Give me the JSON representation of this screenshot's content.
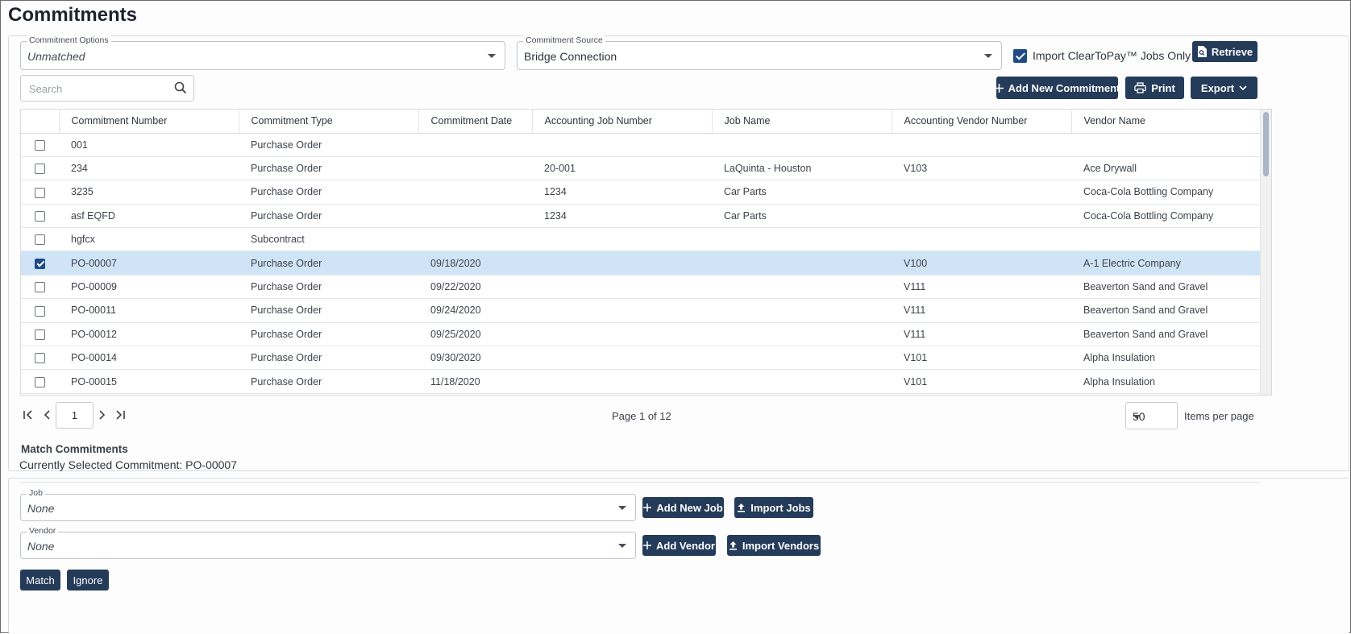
{
  "page": {
    "title": "Commitments"
  },
  "filters": {
    "options_label": "Commitment Options",
    "options_value": "Unmatched",
    "source_label": "Commitment Source",
    "source_value": "Bridge Connection",
    "import_checkbox_label": "Import ClearToPay™ Jobs Only",
    "import_checked": true,
    "retrieve_label": "Retrieve"
  },
  "toolbar": {
    "search_placeholder": "Search",
    "add_commitment_label": "Add New Commitment",
    "print_label": "Print",
    "export_label": "Export"
  },
  "grid": {
    "columns": [
      "Commitment Number",
      "Commitment Type",
      "Commitment Date",
      "Accounting Job Number",
      "Job Name",
      "Accounting Vendor Number",
      "Vendor Name"
    ],
    "rows": [
      {
        "number": "001",
        "type": "Purchase Order",
        "date": "",
        "job_number": "",
        "job_name": "",
        "vendor_number": "",
        "vendor_name": "",
        "checked": false
      },
      {
        "number": "234",
        "type": "Purchase Order",
        "date": "",
        "job_number": "20-001",
        "job_name": "LaQuinta - Houston",
        "vendor_number": "V103",
        "vendor_name": "Ace Drywall",
        "checked": false
      },
      {
        "number": "3235",
        "type": "Purchase Order",
        "date": "",
        "job_number": "1234",
        "job_name": "Car Parts",
        "vendor_number": "",
        "vendor_name": "Coca-Cola Bottling Company",
        "checked": false
      },
      {
        "number": "asf EQFD",
        "type": "Purchase Order",
        "date": "",
        "job_number": "1234",
        "job_name": "Car Parts",
        "vendor_number": "",
        "vendor_name": "Coca-Cola Bottling Company",
        "checked": false
      },
      {
        "number": "hgfcx",
        "type": "Subcontract",
        "date": "",
        "job_number": "",
        "job_name": "",
        "vendor_number": "",
        "vendor_name": "",
        "checked": false
      },
      {
        "number": "PO-00007",
        "type": "Purchase Order",
        "date": "09/18/2020",
        "job_number": "",
        "job_name": "",
        "vendor_number": "V100",
        "vendor_name": "A-1 Electric Company",
        "checked": true
      },
      {
        "number": "PO-00009",
        "type": "Purchase Order",
        "date": "09/22/2020",
        "job_number": "",
        "job_name": "",
        "vendor_number": "V111",
        "vendor_name": "Beaverton Sand and Gravel",
        "checked": false
      },
      {
        "number": "PO-00011",
        "type": "Purchase Order",
        "date": "09/24/2020",
        "job_number": "",
        "job_name": "",
        "vendor_number": "V111",
        "vendor_name": "Beaverton Sand and Gravel",
        "checked": false
      },
      {
        "number": "PO-00012",
        "type": "Purchase Order",
        "date": "09/25/2020",
        "job_number": "",
        "job_name": "",
        "vendor_number": "V111",
        "vendor_name": "Beaverton Sand and Gravel",
        "checked": false
      },
      {
        "number": "PO-00014",
        "type": "Purchase Order",
        "date": "09/30/2020",
        "job_number": "",
        "job_name": "",
        "vendor_number": "V101",
        "vendor_name": "Alpha Insulation",
        "checked": false
      },
      {
        "number": "PO-00015",
        "type": "Purchase Order",
        "date": "11/18/2020",
        "job_number": "",
        "job_name": "",
        "vendor_number": "V101",
        "vendor_name": "Alpha Insulation",
        "checked": false
      }
    ]
  },
  "pager": {
    "current_page": "1",
    "page_info": "Page 1 of 12",
    "per_page": "50",
    "per_page_label": "Items per page"
  },
  "match": {
    "section_title": "Match Commitments",
    "selected_text": "Currently Selected Commitment: PO-00007",
    "job_label": "Job",
    "job_value": "None",
    "add_job_label": "Add New Job",
    "import_jobs_label": "Import Jobs",
    "vendor_label": "Vendor",
    "vendor_value": "None",
    "add_vendor_label": "Add Vendor",
    "import_vendors_label": "Import Vendors",
    "match_label": "Match",
    "ignore_label": "Ignore"
  },
  "colors": {
    "primary_button": "#243b5a",
    "selected_row": "#cfe4f7",
    "checkbox_checked": "#1f4b86"
  },
  "icons": [
    "chevron-down-icon",
    "checkbox-icon",
    "file-search-icon",
    "search-icon",
    "plus-icon",
    "printer-icon",
    "first-page-icon",
    "prev-page-icon",
    "next-page-icon",
    "last-page-icon",
    "upload-icon"
  ]
}
